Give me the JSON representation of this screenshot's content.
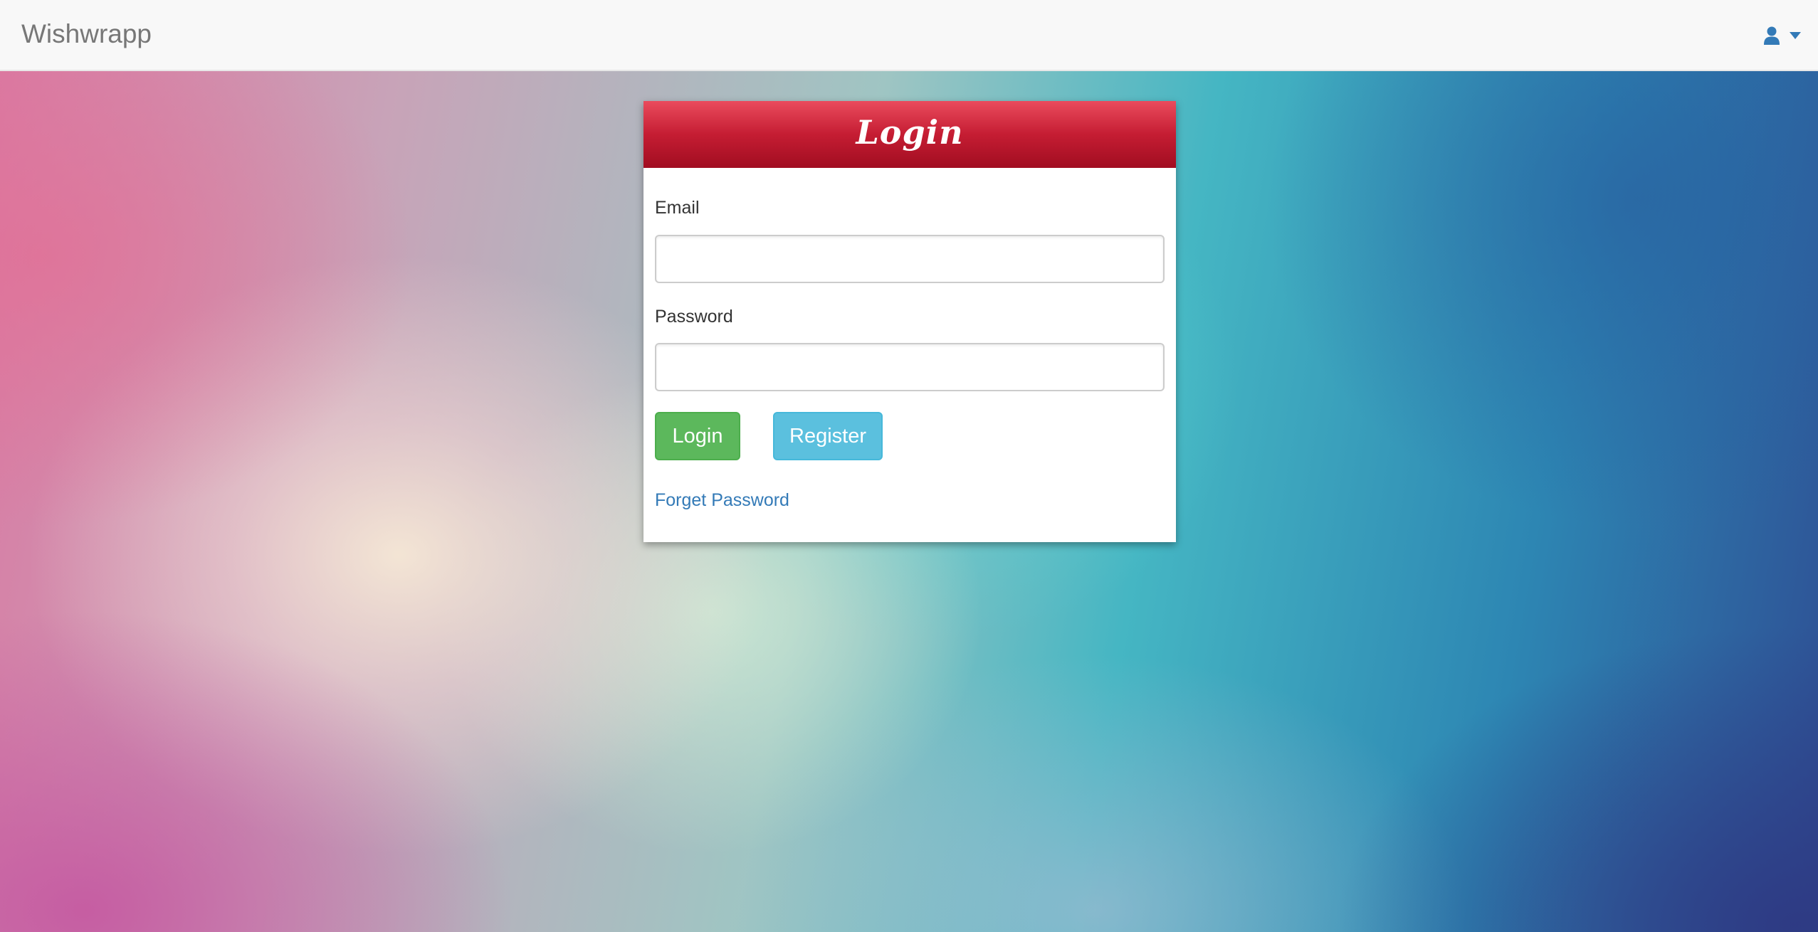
{
  "navbar": {
    "brand": "Wishwrapp",
    "user_menu": {
      "icon": "user-icon",
      "caret": "caret-down-icon",
      "color": "#337ab7"
    }
  },
  "login_panel": {
    "title": "Login",
    "email_label": "Email",
    "email_value": "",
    "password_label": "Password",
    "password_value": "",
    "login_button": "Login",
    "register_button": "Register",
    "forgot_link": "Forget Password"
  },
  "colors": {
    "header_red": "#c51d33",
    "login_green": "#5cb85c",
    "register_blue": "#5bc0de",
    "link_blue": "#337ab7"
  }
}
